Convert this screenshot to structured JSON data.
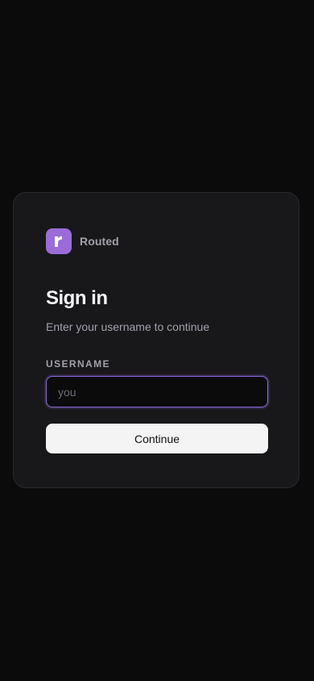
{
  "app": {
    "brand_name": "Routed",
    "logo_icon": "routed-r-logo-icon"
  },
  "colors": {
    "background": "#0b0b0c",
    "card": "#18181b",
    "accent": "#9b6bd8",
    "button": "#f4f4f5"
  },
  "signin": {
    "title": "Sign in",
    "subtitle": "Enter your username to continue",
    "username_label": "USERNAME",
    "username_value": "",
    "username_placeholder": "you",
    "continue_label": "Continue"
  }
}
